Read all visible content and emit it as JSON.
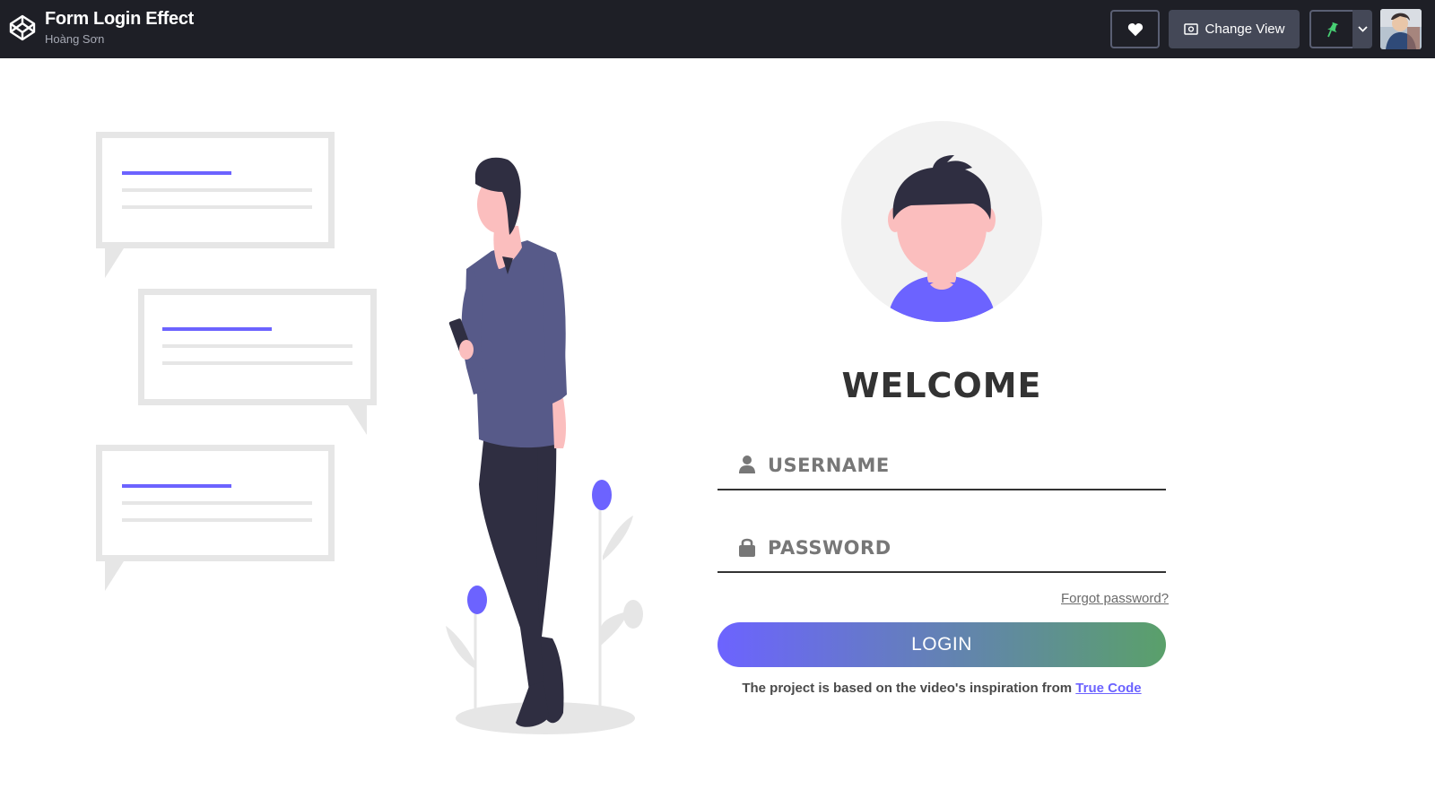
{
  "header": {
    "title": "Form Login Effect",
    "author": "Hoàng Sơn",
    "heart_icon": "heart-icon",
    "change_view_label": "Change View",
    "pin_icon": "pin-icon",
    "dropdown_icon": "chevron-down-icon"
  },
  "form": {
    "welcome": "WELCOME",
    "username_placeholder": "USERNAME",
    "password_placeholder": "PASSWORD",
    "forgot_label": "Forgot password?",
    "login_label": "LOGIN",
    "credit_text": "The project is based on the video's inspiration from ",
    "credit_link": "True Code",
    "accent_color": "#6c63ff",
    "gradient_end_color": "#5aa06a"
  }
}
